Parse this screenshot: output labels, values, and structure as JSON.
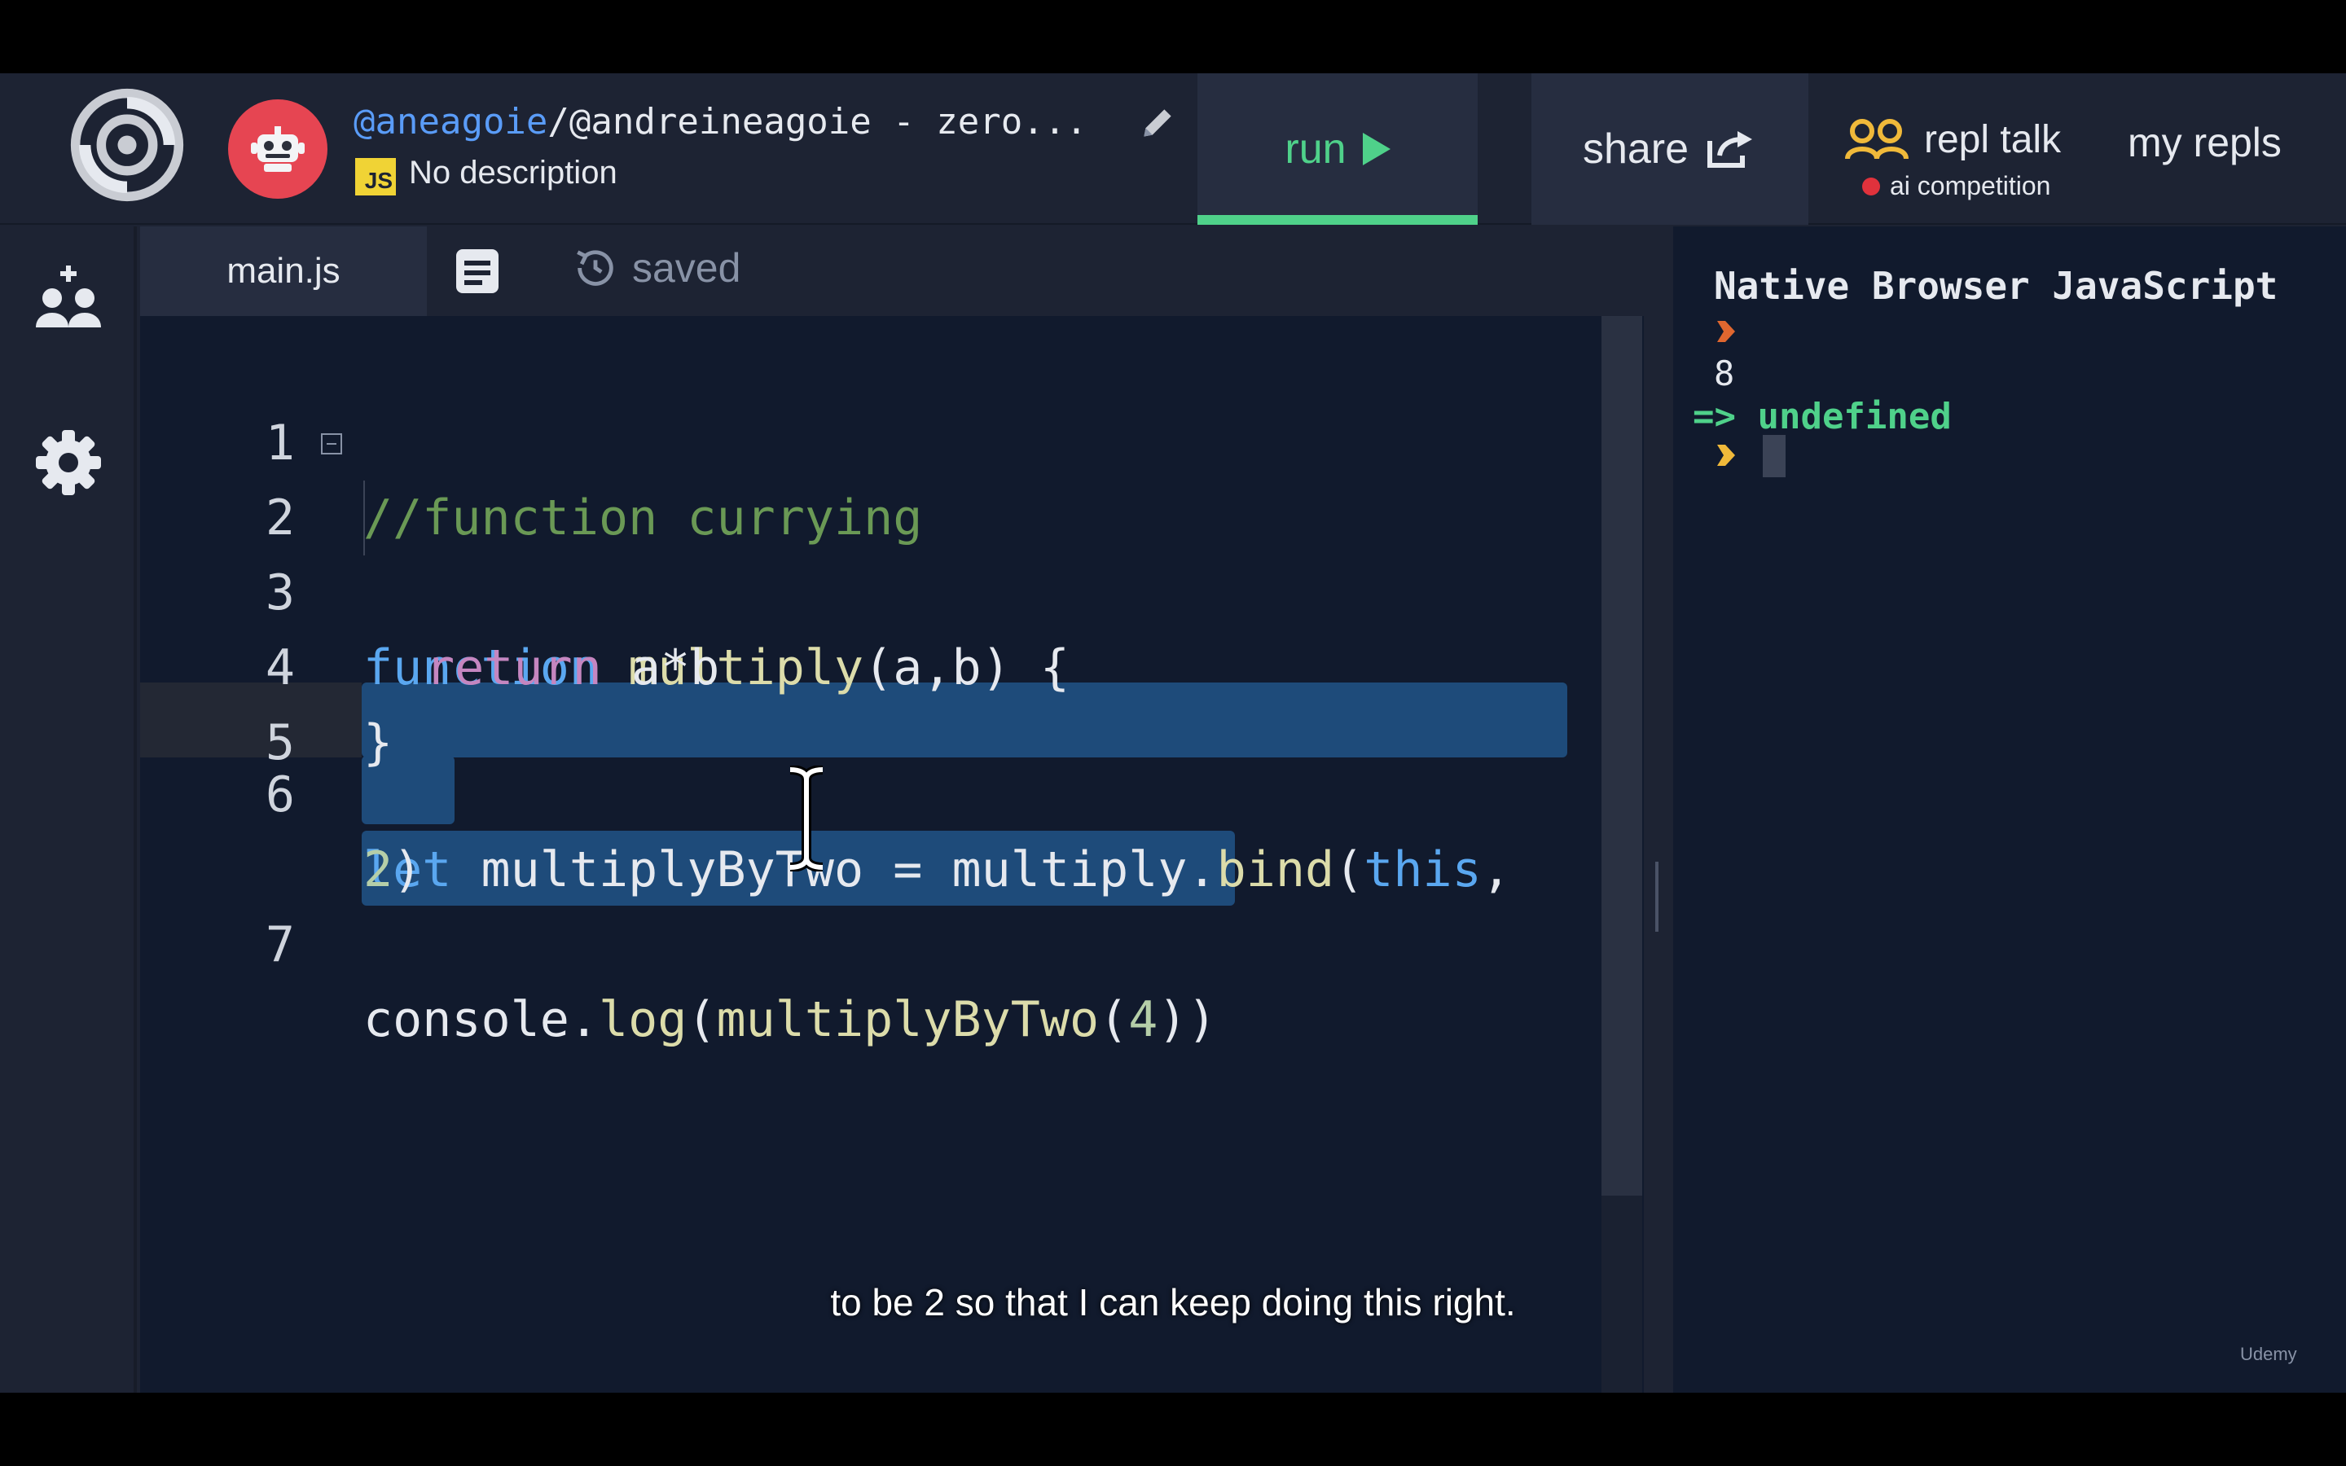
{
  "header": {
    "repl_user": "@aneagoie",
    "repl_name": "/@andreineagoie - zero...",
    "lang_badge": "JS",
    "description": "No description",
    "run_label": "run",
    "share_label": "share",
    "talk_label": "repl talk",
    "talk_sub": "ai competition",
    "my_repls_label": "my repls"
  },
  "sidebar": {
    "icons": [
      "add-people-icon",
      "gear-icon"
    ]
  },
  "editor": {
    "tab_file": "main.js",
    "saved_label": "saved",
    "line_numbers": [
      "1",
      "2",
      "3",
      "4",
      "5",
      "6",
      "7"
    ],
    "code": {
      "l1": "//function currying",
      "l2_kw": "function",
      "l2_fn": "multiply",
      "l2_rest": "(a,b) {",
      "l3_kw": "return",
      "l3_rest": " a*b",
      "l4": "}",
      "l6_kw": "let",
      "l6_a": " multiplyByTwo = multiply.",
      "l6_fn": "bind",
      "l6_b": "(",
      "l6_this": "this",
      "l6_c": ",",
      "l6_wrap_num": "2",
      "l6_wrap_end": ")",
      "l7_a": "console.",
      "l7_fn": "log",
      "l7_b": "(",
      "l7_fn2": "multiplyByTwo",
      "l7_c": "(",
      "l7_num": "4",
      "l7_d": "))"
    }
  },
  "console": {
    "title": "Native Browser JavaScript",
    "output": "8",
    "result": "=> undefined"
  },
  "caption": "to be 2 so that I can keep doing this right.",
  "watermark": "Udemy",
  "colors": {
    "accent_green": "#4fd18a",
    "selection": "#1e4b7a",
    "brand_red": "#e64552"
  }
}
